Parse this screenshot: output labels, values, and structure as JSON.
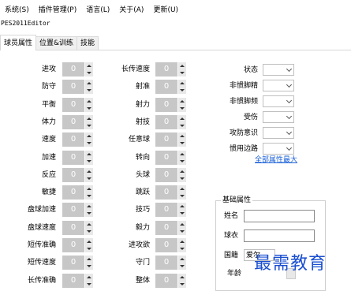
{
  "menu": [
    "系统(S)",
    "插件管理(P)",
    "语言(L)",
    "关于(A)",
    "更新(U)"
  ],
  "app_title": "PES2011Editor",
  "tabs": [
    "球员属性",
    "位置&训练",
    "技能"
  ],
  "stats_left": [
    {
      "label": "进攻",
      "value": "0"
    },
    {
      "label": "防守",
      "value": "0"
    },
    {
      "label": "平衡",
      "value": "0"
    },
    {
      "label": "体力",
      "value": "0"
    },
    {
      "label": "速度",
      "value": "0"
    },
    {
      "label": "加速",
      "value": "0"
    },
    {
      "label": "反应",
      "value": "0"
    },
    {
      "label": "敏捷",
      "value": "0"
    },
    {
      "label": "盘球加速",
      "value": "0"
    },
    {
      "label": "盘球速度",
      "value": "0"
    },
    {
      "label": "短传准确",
      "value": "0"
    },
    {
      "label": "短传速度",
      "value": "0"
    },
    {
      "label": "长传准确",
      "value": "0"
    }
  ],
  "stats_right": [
    {
      "label": "长传速度",
      "value": "0"
    },
    {
      "label": "射准",
      "value": "0"
    },
    {
      "label": "射力",
      "value": "0"
    },
    {
      "label": "射技",
      "value": "0"
    },
    {
      "label": "任意球",
      "value": "0"
    },
    {
      "label": "转向",
      "value": "0"
    },
    {
      "label": "头球",
      "value": "0"
    },
    {
      "label": "跳跃",
      "value": "0"
    },
    {
      "label": "技巧",
      "value": "0"
    },
    {
      "label": "毅力",
      "value": "0"
    },
    {
      "label": "进攻欲",
      "value": "0"
    },
    {
      "label": "守门",
      "value": "0"
    },
    {
      "label": "整体",
      "value": "0"
    }
  ],
  "dropdowns": [
    {
      "label": "状态",
      "value": ""
    },
    {
      "label": "非惯脚精",
      "value": ""
    },
    {
      "label": "非惯脚频",
      "value": ""
    },
    {
      "label": "受伤",
      "value": ""
    },
    {
      "label": "攻防意识",
      "value": ""
    },
    {
      "label": "惯用边路",
      "value": ""
    }
  ],
  "max_all_link": "全部属性最大",
  "basic": {
    "title": "基础属性",
    "name_label": "姓名",
    "name_value": "",
    "jersey_label": "球衣",
    "jersey_value": "",
    "nationality_label": "国籍",
    "nationality_value": "爱尔",
    "age_label": "年龄"
  },
  "watermark": "最需教育"
}
